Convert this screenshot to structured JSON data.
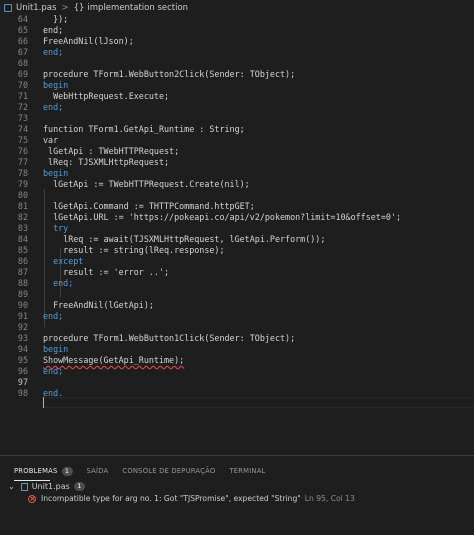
{
  "breadcrumb": {
    "file": "Unit1.pas",
    "separator": ">",
    "symbol_icon": "{}",
    "section": "implementation section"
  },
  "editor": {
    "lines": [
      {
        "num": "64",
        "code": "  });"
      },
      {
        "num": "65",
        "code": "end;"
      },
      {
        "num": "66",
        "code": "FreeAndNil(lJson);"
      },
      {
        "num": "67",
        "code": "end;"
      },
      {
        "num": "68",
        "code": ""
      },
      {
        "num": "69",
        "code": "procedure TForm1.WebButton2Click(Sender: TObject);"
      },
      {
        "num": "70",
        "code": "begin"
      },
      {
        "num": "71",
        "code": "  WebHttpRequest.Execute;"
      },
      {
        "num": "72",
        "code": "end;"
      },
      {
        "num": "73",
        "code": ""
      },
      {
        "num": "74",
        "code": "function TForm1.GetApi_Runtime : String;"
      },
      {
        "num": "75",
        "code": "var"
      },
      {
        "num": "76",
        "code": " lGetApi : TWebHTTPRequest;"
      },
      {
        "num": "77",
        "code": " lReq: TJSXMLHttpRequest;"
      },
      {
        "num": "78",
        "code": "begin"
      },
      {
        "num": "79",
        "code": "  lGetApi := TWebHTTPRequest.Create(nil);"
      },
      {
        "num": "80",
        "code": ""
      },
      {
        "num": "81",
        "code": "  lGetApi.Command := THTTPCommand.httpGET;"
      },
      {
        "num": "82",
        "code": "  lGetApi.URL := 'https://pokeapi.co/api/v2/pokemon?limit=10&offset=0';"
      },
      {
        "num": "83",
        "code": "  try"
      },
      {
        "num": "84",
        "code": "    lReq := await(TJSXMLHttpRequest, lGetApi.Perform());"
      },
      {
        "num": "85",
        "code": "    result := string(lReq.response);"
      },
      {
        "num": "86",
        "code": "  except"
      },
      {
        "num": "87",
        "code": "    result := 'error ..';"
      },
      {
        "num": "88",
        "code": "  end;"
      },
      {
        "num": "89",
        "code": ""
      },
      {
        "num": "90",
        "code": "  FreeAndNil(lGetApi);"
      },
      {
        "num": "91",
        "code": "end;"
      },
      {
        "num": "92",
        "code": ""
      },
      {
        "num": "93",
        "code": "procedure TForm1.WebButton1Click(Sender: TObject);"
      },
      {
        "num": "94",
        "code": "begin"
      },
      {
        "num": "95",
        "code": "ShowMessage(GetApi_Runtime);"
      },
      {
        "num": "96",
        "code": "end;"
      },
      {
        "num": "97",
        "code": ""
      },
      {
        "num": "98",
        "code": "end."
      }
    ],
    "active_line": "97"
  },
  "panel": {
    "tabs": [
      {
        "label": "PROBLEMAS",
        "badge": "1"
      },
      {
        "label": "SAÍDA"
      },
      {
        "label": "CONSOLE DE DEPURAÇÃO"
      },
      {
        "label": "TERMINAL"
      }
    ],
    "problem_file": "Unit1.pas",
    "problem_file_count": "1",
    "problem_message": "Incompatible type for arg no. 1: Got \"TJSPromise\", expected \"String\"",
    "problem_location": "Ln 95, Col 13"
  },
  "colors": {
    "background": "#1e1e1e",
    "keyword": "#569cd6",
    "type_name": "#4ec9b0",
    "string": "#ce9178",
    "error": "#f14c4c"
  }
}
